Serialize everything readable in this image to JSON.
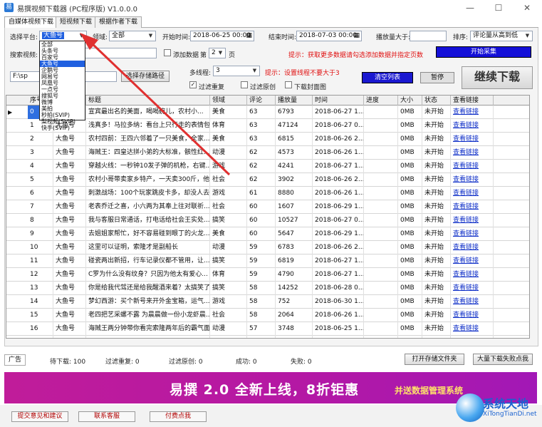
{
  "window": {
    "title": "易撰视频下载器 (PC程序版) V1.0.0.0",
    "minimize": "—",
    "maximize": "☐",
    "close": "✕"
  },
  "tabs": [
    "自媒体视频下载",
    "短视频下载",
    "根据作者下载"
  ],
  "toolbar": {
    "platform_label": "选择平台:",
    "platform_value": "大鱼号",
    "domain_label": "领域:",
    "domain_value": "全部",
    "start_time_label": "开始时间:",
    "start_time_value": "2018-06-25 00:00",
    "end_time_label": "结束时间:",
    "end_time_value": "2018-07-03 00:00",
    "plays_label": "播放量大于:",
    "sort_label": "排序:",
    "sort_value": "评论量从高到低",
    "search_label": "搜索视频:",
    "add_data_label": "添加数据",
    "page_prefix": "第",
    "page_value": "2",
    "page_suffix": "页",
    "tip_add_data": "提示：获取更多数据请勾选添加数据并指定页数",
    "start_collect": "开始采集",
    "save_path_value": "F:\\sp",
    "choose_path": "选择存储路径",
    "threads_label": "多线程:",
    "threads_value": "3",
    "tip_threads": "提示：设置线程不要大于3",
    "filter_dup": "过滤重复",
    "filter_orig": "过滤原创",
    "download_cover": "下载封面图",
    "clear_list": "清空列表",
    "pause": "暂停",
    "continue_download": "继续下载"
  },
  "platform_options": [
    "全部",
    "头条号",
    "百家号",
    "大鱼号",
    "企鹅号",
    "网易号",
    "凤凰号",
    "一点号",
    "搜狐号",
    "微博",
    "美拍",
    "秒拍(SVIP)",
    "梨视频(SVIP)",
    "快手(SVIP)"
  ],
  "platform_selected_index": 3,
  "columns": [
    "序号",
    "来源",
    "标题",
    "领域",
    "评论",
    "播放量",
    "时间",
    "进度",
    "大小",
    "状态",
    "查看链接"
  ],
  "rows": [
    {
      "no": "0",
      "src": "大鱼号",
      "title": "宣宾最出名的美面，喝喝碗儿，农村小...",
      "domain": "美食",
      "comments": "63",
      "plays": "6793",
      "time": "2018-06-27 1...",
      "progress": "",
      "size": "0MB",
      "status": "未开始",
      "link": "查看链接"
    },
    {
      "no": "1",
      "src": "大鱼号",
      "title": "浅真多！马拉多纳：看台上只行走的表情包",
      "domain": "体育",
      "comments": "63",
      "plays": "47124",
      "time": "2018-06-27 0...",
      "progress": "",
      "size": "0MB",
      "status": "未开始",
      "link": "查看链接"
    },
    {
      "no": "2",
      "src": "大鱼号",
      "title": "农村四前：王四六邻着了一只美食，全家...",
      "domain": "美食",
      "comments": "63",
      "plays": "6815",
      "time": "2018-06-26 2...",
      "progress": "",
      "size": "0MB",
      "status": "未开始",
      "link": "查看链接"
    },
    {
      "no": "3",
      "src": "大鱼号",
      "title": "海贼王：四皇达拼小弟的大标准，骸性红...",
      "domain": "动漫",
      "comments": "62",
      "plays": "4573",
      "time": "2018-06-26 1...",
      "progress": "",
      "size": "0MB",
      "status": "未开始",
      "link": "查看链接"
    },
    {
      "no": "4",
      "src": "大鱼号",
      "title": "穿越火线：一秒钟10发子弹的机枪，右键...",
      "domain": "游戏",
      "comments": "62",
      "plays": "4241",
      "time": "2018-06-27 1...",
      "progress": "",
      "size": "0MB",
      "status": "未开始",
      "link": "查看链接"
    },
    {
      "no": "5",
      "src": "大鱼号",
      "title": "农村小哥带卖家乡特产，一天卖300斤，他...",
      "domain": "社会",
      "comments": "62",
      "plays": "3902",
      "time": "2018-06-26 2...",
      "progress": "",
      "size": "0MB",
      "status": "未开始",
      "link": "查看链接"
    },
    {
      "no": "6",
      "src": "大鱼号",
      "title": "刺激战场：100个玩家跳皮卡多，却没人去...",
      "domain": "游戏",
      "comments": "61",
      "plays": "8880",
      "time": "2018-06-26 1...",
      "progress": "",
      "size": "0MB",
      "status": "未开始",
      "link": "查看链接"
    },
    {
      "no": "7",
      "src": "大鱼号",
      "title": "老表乔迁之喜，小六两为其奉上往对联祈...",
      "domain": "社会",
      "comments": "60",
      "plays": "1607",
      "time": "2018-06-29 1...",
      "progress": "",
      "size": "0MB",
      "status": "未开始",
      "link": "查看链接"
    },
    {
      "no": "8",
      "src": "大鱼号",
      "title": "我与客服日常通话，打电话给社会王实处...",
      "domain": "搞笑",
      "comments": "60",
      "plays": "10527",
      "time": "2018-06-27 0...",
      "progress": "",
      "size": "0MB",
      "status": "未开始",
      "link": "查看链接"
    },
    {
      "no": "9",
      "src": "大鱼号",
      "title": "去姐姐家帮忙，好不容易碰到眼丁的火龙...",
      "domain": "美食",
      "comments": "60",
      "plays": "5647",
      "time": "2018-06-29 1...",
      "progress": "",
      "size": "0MB",
      "status": "未开始",
      "link": "查看链接"
    },
    {
      "no": "10",
      "src": "大鱼号",
      "title": "这里可以证明，索隆才是副船长",
      "domain": "动漫",
      "comments": "59",
      "plays": "6783",
      "time": "2018-06-26 2...",
      "progress": "",
      "size": "0MB",
      "status": "未开始",
      "link": "查看链接"
    },
    {
      "no": "11",
      "src": "大鱼号",
      "title": "碰瓷两出新招，行车记录仪都不管用，让...",
      "domain": "搞笑",
      "comments": "59",
      "plays": "6819",
      "time": "2018-06-27 1...",
      "progress": "",
      "size": "0MB",
      "status": "未开始",
      "link": "查看链接"
    },
    {
      "no": "12",
      "src": "大鱼号",
      "title": "C罗为什么没有纹身？只因为他太有爱心...",
      "domain": "体育",
      "comments": "59",
      "plays": "4790",
      "time": "2018-06-27 1...",
      "progress": "",
      "size": "0MB",
      "status": "未开始",
      "link": "查看链接"
    },
    {
      "no": "13",
      "src": "大鱼号",
      "title": "你是给我代驾还是给我醒酒来着？太搞笑了",
      "domain": "搞笑",
      "comments": "58",
      "plays": "14252",
      "time": "2018-06-28 0...",
      "progress": "",
      "size": "0MB",
      "status": "未开始",
      "link": "查看链接"
    },
    {
      "no": "14",
      "src": "大鱼号",
      "title": "梦幻西游：买个新号来开外金宝箱，运气...",
      "domain": "游戏",
      "comments": "58",
      "plays": "752",
      "time": "2018-06-30 1...",
      "progress": "",
      "size": "0MB",
      "status": "未开始",
      "link": "查看链接"
    },
    {
      "no": "15",
      "src": "大鱼号",
      "title": "老四把艺采螺不露 为晨晨做一份小龙虾晨...",
      "domain": "社会",
      "comments": "58",
      "plays": "2064",
      "time": "2018-06-26 1...",
      "progress": "",
      "size": "0MB",
      "status": "未开始",
      "link": "查看链接"
    },
    {
      "no": "16",
      "src": "大鱼号",
      "title": "海贼王两分钟带你看完索隆两年后的霸气面...",
      "domain": "动漫",
      "comments": "57",
      "plays": "3748",
      "time": "2018-06-25 1...",
      "progress": "",
      "size": "0MB",
      "status": "未开始",
      "link": "查看链接"
    },
    {
      "no": "17",
      "src": "大鱼号",
      "title": "小型两两月正席，厨师们一大早就过来拿...",
      "domain": "旅游",
      "comments": "57",
      "plays": "7626",
      "time": "2018-06-26 1...",
      "progress": "",
      "size": "0MB",
      "status": "未开始",
      "link": "查看链接"
    }
  ],
  "status": {
    "ad_tab": "广告",
    "pending": "待下载: 100",
    "filter_dup": "过滤重复: 0",
    "filter_orig": "过滤原创: 0",
    "success": "成功: 0",
    "fail": "失败: 0",
    "open_folder": "打开存储文件夹",
    "batch_fail": "大量下载失败点我"
  },
  "banner": {
    "main": "易撰 2.0 全新上线，8折钜惠",
    "sub": "并送数据管理系统"
  },
  "footer": {
    "feedback": "提交意见和建议",
    "contact": "联系客服",
    "pay": "付费点我"
  },
  "watermark": {
    "name": "系统天地",
    "url": "XiTongTianDi.net"
  },
  "colors": {
    "accent": "#1410d8",
    "banner": "#b418a4",
    "tip_red": "#e01010",
    "link_blue": "#1030c8",
    "arrow": "#e03030"
  }
}
